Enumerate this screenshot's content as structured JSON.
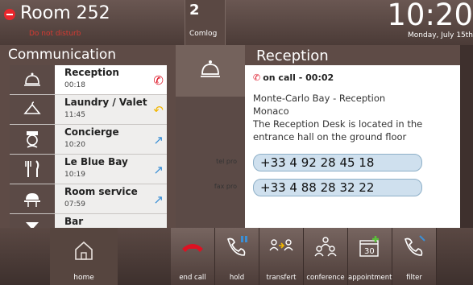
{
  "header": {
    "room": "Room 252",
    "status": "Do not disturb",
    "notif_count": "2",
    "notif_label": "Comlog",
    "clock": "10:20",
    "date": "Monday, July 15th"
  },
  "left": {
    "title": "Communication",
    "items": [
      {
        "name": "Reception",
        "time": "00:18",
        "icon": "bell-icon"
      },
      {
        "name": "Laundry / Valet",
        "time": "11:45",
        "icon": "hanger-icon"
      },
      {
        "name": "Concierge",
        "time": "10:20",
        "icon": "concierge-icon"
      },
      {
        "name": "Le Blue Bay",
        "time": "10:19",
        "icon": "cutlery-icon"
      },
      {
        "name": "Room service",
        "time": "07:59",
        "icon": "room-service-icon"
      },
      {
        "name": "Bar",
        "time": "",
        "icon": "cocktail-icon"
      }
    ]
  },
  "detail": {
    "title": "Reception",
    "oncall": "on call - 00:02",
    "line1": "Monte-Carlo Bay - Reception",
    "line2": "Monaco",
    "line3": "The Reception Desk is located in the entrance hall on the ground floor",
    "tel_label": "tel pro",
    "tel_value": "+33 4 92 28 45 18",
    "fax_label": "fax pro",
    "fax_value": "+33 4 88 28 32 22"
  },
  "bottom": {
    "home": "home",
    "actions": [
      "end call",
      "hold",
      "transfert",
      "conference",
      "appointment",
      "filter"
    ],
    "calendar_day": "30"
  },
  "colors": {
    "accent_red": "#d12",
    "accent_blue": "#3a8fd6",
    "accent_yellow": "#f2b600",
    "accent_green": "#5bbf3a"
  }
}
